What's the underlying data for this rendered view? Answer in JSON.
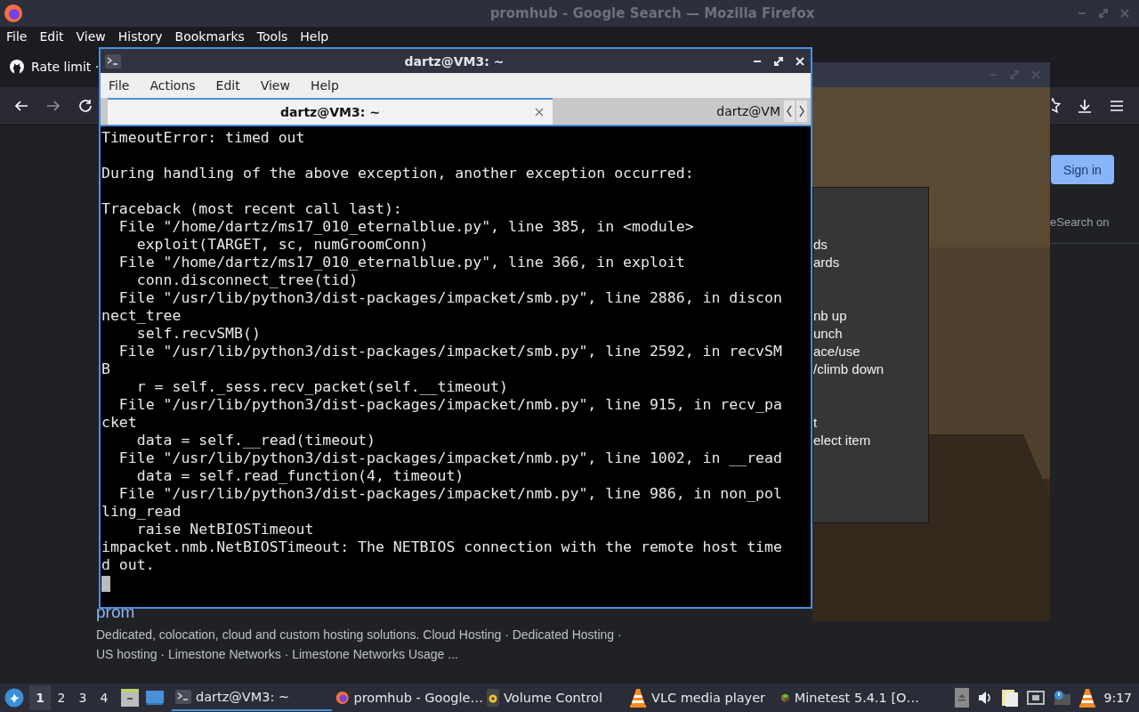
{
  "firefox": {
    "title": "promhub - Google Search — Mozilla Firefox",
    "menu": [
      "File",
      "Edit",
      "View",
      "History",
      "Bookmarks",
      "Tools",
      "Help"
    ],
    "tab": {
      "label": "Rate limit ·"
    },
    "page": {
      "sign_in": "Sign in",
      "side_text": "eSearch on",
      "result_title": "prom",
      "snippet_lines": [
        "Dedicated, colocation, cloud and custom hosting solutions. Cloud Hosting · Dedicated Hosting ·",
        "US hosting · Limestone Networks · Limestone Networks Usage ..."
      ]
    }
  },
  "minetest": {
    "help_groups": [
      [
        "ds",
        "ards"
      ],
      [
        "nb up",
        "unch",
        "ace/use",
        "/climb down"
      ],
      [
        "t",
        "elect item"
      ]
    ]
  },
  "terminal": {
    "title": "dartz@VM3: ~",
    "menu": [
      "File",
      "Actions",
      "Edit",
      "View",
      "Help"
    ],
    "tabs": [
      {
        "label": "dartz@VM3: ~",
        "selected": true
      },
      {
        "label": "dartz@VM",
        "selected": false
      }
    ],
    "output": "TimeoutError: timed out\n\nDuring handling of the above exception, another exception occurred:\n\nTraceback (most recent call last):\n  File \"/home/dartz/ms17_010_eternalblue.py\", line 385, in <module>\n    exploit(TARGET, sc, numGroomConn)\n  File \"/home/dartz/ms17_010_eternalblue.py\", line 366, in exploit\n    conn.disconnect_tree(tid)\n  File \"/usr/lib/python3/dist-packages/impacket/smb.py\", line 2886, in discon\nnect_tree\n    self.recvSMB()\n  File \"/usr/lib/python3/dist-packages/impacket/smb.py\", line 2592, in recvSM\nB\n    r = self._sess.recv_packet(self.__timeout)\n  File \"/usr/lib/python3/dist-packages/impacket/nmb.py\", line 915, in recv_pa\ncket\n    data = self.__read(timeout)\n  File \"/usr/lib/python3/dist-packages/impacket/nmb.py\", line 1002, in __read\n    data = self.read_function(4, timeout)\n  File \"/usr/lib/python3/dist-packages/impacket/nmb.py\", line 986, in non_pol\nling_read\n    raise NetBIOSTimeout\nimpacket.nmb.NetBIOSTimeout: The NETBIOS connection with the remote host time\nd out.",
    "cursor": true
  },
  "taskbar": {
    "workspaces": [
      {
        "label": "1",
        "selected": true
      },
      {
        "label": "2",
        "selected": false
      },
      {
        "label": "3",
        "selected": false
      },
      {
        "label": "4",
        "selected": false
      }
    ],
    "tasks": [
      {
        "kind": "terminal",
        "label": "dartz@VM3: ~",
        "selected": true
      },
      {
        "kind": "firefox",
        "label": "promhub - Google…",
        "selected": false
      },
      {
        "kind": "volume",
        "label": "Volume Control",
        "selected": false
      },
      {
        "kind": "vlc",
        "label": "VLC media player",
        "selected": false
      },
      {
        "kind": "minetest",
        "label": "Minetest 5.4.1 [O…",
        "selected": false
      }
    ],
    "clock": "9:17"
  }
}
